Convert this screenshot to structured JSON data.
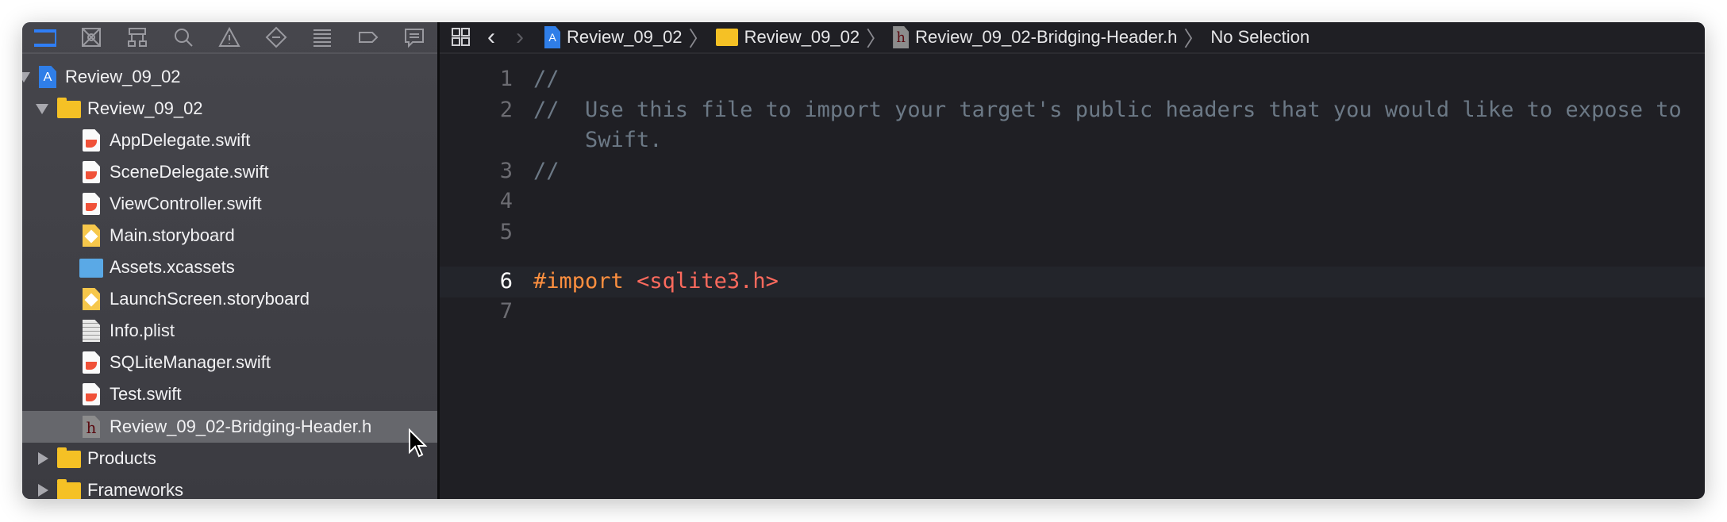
{
  "navigator_tabs": [
    "project-navigator",
    "source-control-navigator",
    "symbol-navigator",
    "find-navigator",
    "issue-navigator",
    "test-navigator",
    "debug-navigator",
    "breakpoint-navigator",
    "report-navigator"
  ],
  "tree": [
    {
      "label": "Review_09_02",
      "type": "project",
      "level": 0,
      "expanded": true
    },
    {
      "label": "Review_09_02",
      "type": "folder",
      "level": 1,
      "expanded": true
    },
    {
      "label": "AppDelegate.swift",
      "type": "swift",
      "level": 2
    },
    {
      "label": "SceneDelegate.swift",
      "type": "swift",
      "level": 2
    },
    {
      "label": "ViewController.swift",
      "type": "swift",
      "level": 2
    },
    {
      "label": "Main.storyboard",
      "type": "storyboard",
      "level": 2
    },
    {
      "label": "Assets.xcassets",
      "type": "assets",
      "level": 2
    },
    {
      "label": "LaunchScreen.storyboard",
      "type": "storyboard",
      "level": 2
    },
    {
      "label": "Info.plist",
      "type": "plist",
      "level": 2
    },
    {
      "label": "SQLiteManager.swift",
      "type": "swift",
      "level": 2
    },
    {
      "label": "Test.swift",
      "type": "swift",
      "level": 2
    },
    {
      "label": "Review_09_02-Bridging-Header.h",
      "type": "header",
      "level": 2,
      "selected": true
    },
    {
      "label": "Products",
      "type": "folder",
      "level": 1,
      "expanded": false
    },
    {
      "label": "Frameworks",
      "type": "folder",
      "level": 1,
      "expanded": false
    }
  ],
  "breadcrumb": [
    "Review_09_02",
    "Review_09_02",
    "Review_09_02-Bridging-Header.h",
    "No Selection"
  ],
  "code": {
    "l1": "//",
    "l2a": "//  Use this file to import your target's public headers that you would like to expose to",
    "l2b": "    Swift.",
    "l3": "//",
    "import_kw": "#import",
    "import_path": "<sqlite3.h>",
    "numbers": [
      "1",
      "2",
      "3",
      "4",
      "5",
      "6",
      "7"
    ]
  },
  "colors": {
    "accent": "#2f7ef6",
    "keyword": "#fd8f3f",
    "string": "#fc6a5d",
    "comment": "#6c7986"
  }
}
